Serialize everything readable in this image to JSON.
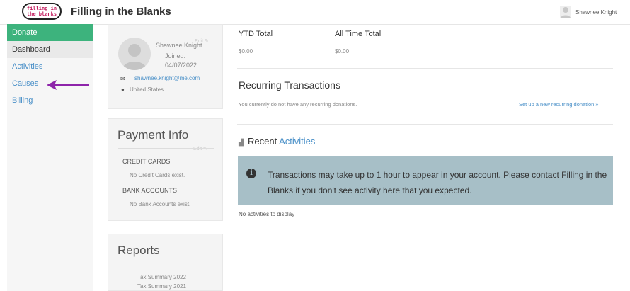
{
  "header": {
    "logo_line1": "filling in",
    "logo_line2": "the blanks",
    "app_title": "Filling in the Blanks",
    "user_name": "Shawnee Knight"
  },
  "sidebar": {
    "items": [
      {
        "label": "Donate"
      },
      {
        "label": "Dashboard"
      },
      {
        "label": "Activities"
      },
      {
        "label": "Causes"
      },
      {
        "label": "Billing"
      }
    ]
  },
  "profile": {
    "name": "Shawnee Knight",
    "edit": "Edit",
    "joined_label": "Joined:",
    "joined_date": "04/07/2022",
    "email": "shawnee.knight@me.com",
    "location": "United States"
  },
  "payment": {
    "title": "Payment Info",
    "edit": "Edit",
    "credit_header": "CREDIT CARDS",
    "credit_empty": "No Credit Cards exist.",
    "bank_header": "BANK ACCOUNTS",
    "bank_empty": "No Bank Accounts exist."
  },
  "reports": {
    "title": "Reports",
    "items": [
      "Tax Summary 2022",
      "Tax Summary 2021"
    ]
  },
  "totals": {
    "ytd_label": "YTD Total",
    "ytd_value": "$0.00",
    "all_label": "All Time Total",
    "all_value": "$0.00"
  },
  "recurring": {
    "title": "Recurring Transactions",
    "empty_text": "You currently do not have any recurring donations.",
    "setup_link": "Set up a new recurring donation »"
  },
  "recent": {
    "title_prefix": "Recent",
    "title_link": "Activities",
    "alert_text": "Transactions may take up to 1 hour to appear in your account. Please contact Filling in the Blanks if you don't see activity here that you expected.",
    "empty_text": "No activities to display"
  },
  "colors": {
    "donate_green": "#3db37d",
    "link_blue": "#4a90c8",
    "alert_bg": "#a7bfc7",
    "arrow_purple": "#8e24aa",
    "logo_pink": "#c2185b"
  }
}
